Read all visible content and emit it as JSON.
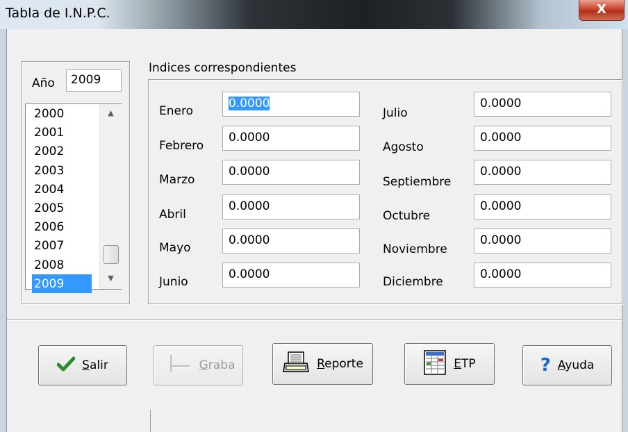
{
  "window": {
    "title": "Tabla de I.N.P.C.",
    "close_glyph": "X"
  },
  "year_box": {
    "label": "Año",
    "value": "2009",
    "years": [
      "2000",
      "2001",
      "2002",
      "2003",
      "2004",
      "2005",
      "2006",
      "2007",
      "2008",
      "2009"
    ],
    "selected": "2009",
    "scroll_up_glyph": "▲",
    "scroll_down_glyph": "▼"
  },
  "indices": {
    "group_label": "Indices correspondientes",
    "left": [
      {
        "month": "Enero",
        "value": "0.0000"
      },
      {
        "month": "Febrero",
        "value": "0.0000"
      },
      {
        "month": "Marzo",
        "value": "0.0000"
      },
      {
        "month": "Abril",
        "value": "0.0000"
      },
      {
        "month": "Mayo",
        "value": "0.0000"
      },
      {
        "month": "Junio",
        "value": "0.0000"
      }
    ],
    "right": [
      {
        "month": "Julio",
        "value": "0.0000"
      },
      {
        "month": "Agosto",
        "value": "0.0000"
      },
      {
        "month": "Septiembre",
        "value": "0.0000"
      },
      {
        "month": "Octubre",
        "value": "0.0000"
      },
      {
        "month": "Noviembre",
        "value": "0.0000"
      },
      {
        "month": "Diciembre",
        "value": "0.0000"
      }
    ]
  },
  "buttons": {
    "salir": {
      "hotkey": "S",
      "rest": "alir",
      "icon": "checkmark-icon"
    },
    "graba": {
      "hotkey": "G",
      "rest": "raba",
      "icon": "save-icon"
    },
    "reporte": {
      "hotkey": "R",
      "rest": "eporte",
      "icon": "printer-icon"
    },
    "etp": {
      "hotkey": "E",
      "rest": "TP",
      "icon": "spreadsheet-icon"
    },
    "ayuda": {
      "hotkey": "A",
      "rest": "yuda",
      "icon": "help-icon",
      "glyph": "?"
    }
  },
  "colors": {
    "selection": "#3399ff",
    "check": "#2e8b2e",
    "help": "#1e66d0"
  }
}
